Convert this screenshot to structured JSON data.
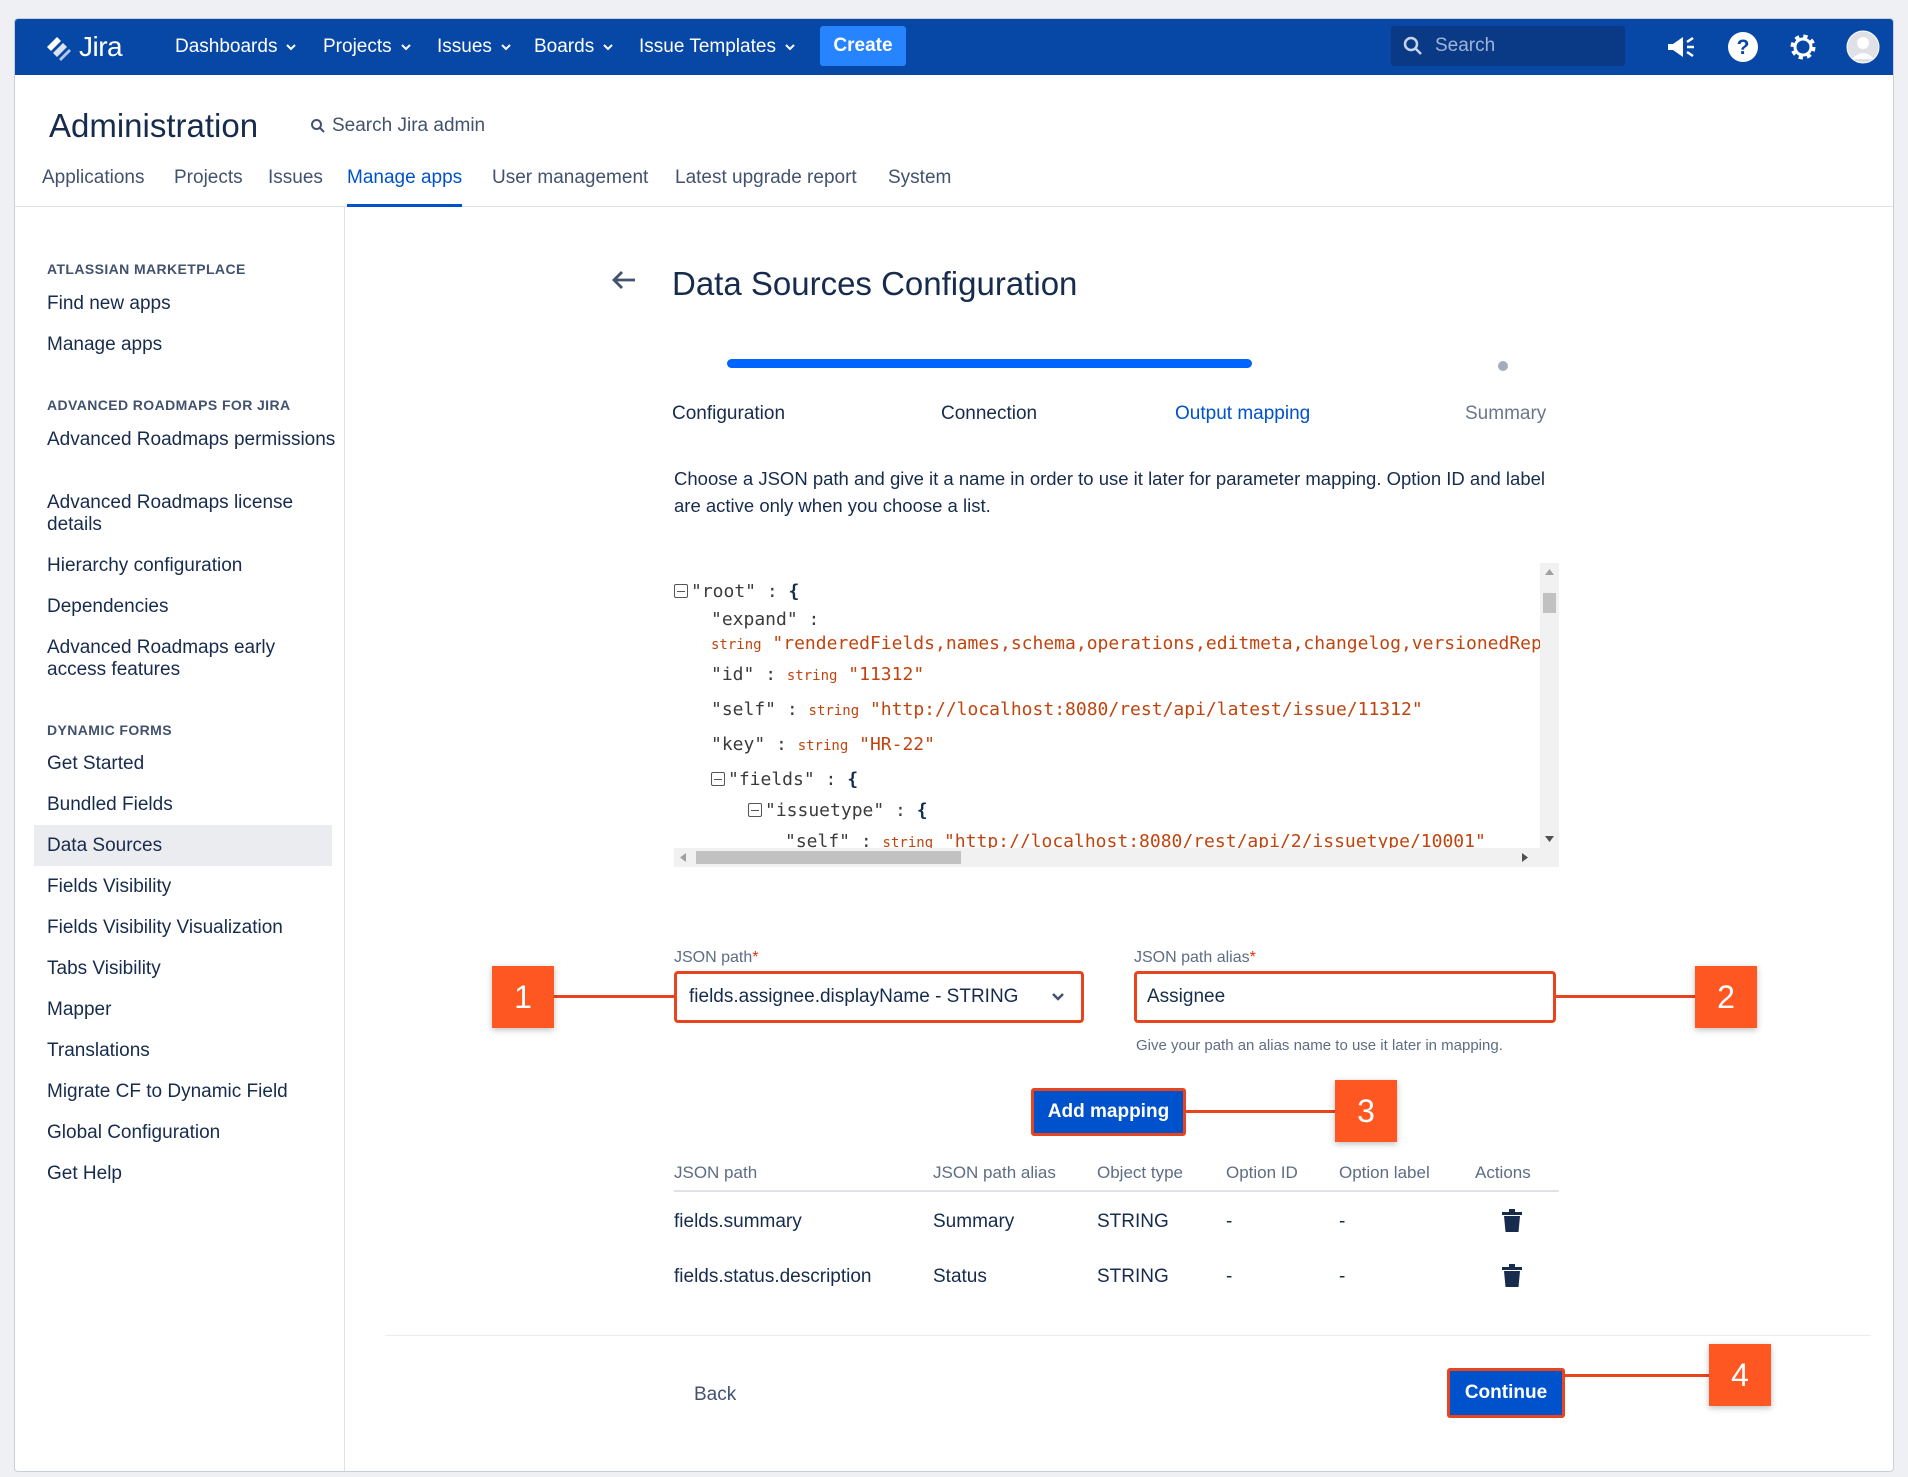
{
  "topnav": {
    "logo": "Jira",
    "items": [
      "Dashboards",
      "Projects",
      "Issues",
      "Boards",
      "Issue Templates"
    ],
    "create_label": "Create",
    "search_placeholder": "Search"
  },
  "admin": {
    "title": "Administration",
    "search_label": "Search Jira admin",
    "tabs": [
      "Applications",
      "Projects",
      "Issues",
      "Manage apps",
      "User management",
      "Latest upgrade report",
      "System"
    ],
    "active_tab": "Manage apps"
  },
  "sidebar": {
    "sections": [
      {
        "heading": "ATLASSIAN MARKETPLACE",
        "items": [
          "Find new apps",
          "Manage apps"
        ]
      },
      {
        "heading": "ADVANCED ROADMAPS FOR JIRA",
        "items": [
          "Advanced Roadmaps permissions",
          "Advanced Roadmaps license details",
          "Hierarchy configuration",
          "Dependencies",
          "Advanced Roadmaps early access features"
        ]
      },
      {
        "heading": "DYNAMIC FORMS",
        "items": [
          "Get Started",
          "Bundled Fields",
          "Data Sources",
          "Fields Visibility",
          "Fields Visibility Visualization",
          "Tabs Visibility",
          "Mapper",
          "Translations",
          "Migrate CF to Dynamic Field",
          "Global Configuration",
          "Get Help"
        ]
      }
    ],
    "selected": "Data Sources"
  },
  "page": {
    "title": "Data Sources Configuration",
    "progress_fraction": 0.75,
    "steps": [
      "Configuration",
      "Connection",
      "Output mapping",
      "Summary"
    ],
    "current_step": "Output mapping",
    "description": "Choose a JSON path and give it a name in order to use it later for parameter mapping. Option ID and label are active only when you choose a list."
  },
  "json_viewer": {
    "lines": [
      {
        "key": "\"root\"",
        "sep": " : ",
        "brace": "{"
      },
      {
        "key": "\"expand\"",
        "sep": " :"
      },
      {
        "type": "string",
        "value": "\"renderedFields,names,schema,operations,editmeta,changelog,versionedRepr"
      },
      {
        "key": "\"id\"",
        "sep": " : ",
        "type": "string",
        "value": "\"11312\""
      },
      {
        "key": "\"self\"",
        "sep": " : ",
        "type": "string",
        "value": "\"http://localhost:8080/rest/api/latest/issue/11312\""
      },
      {
        "key": "\"key\"",
        "sep": " : ",
        "type": "string",
        "value": "\"HR-22\""
      },
      {
        "key": "\"fields\"",
        "sep": " : ",
        "brace": "{"
      },
      {
        "key": "\"issuetype\"",
        "sep": " : ",
        "brace": "{"
      },
      {
        "key": "\"self\"",
        "sep": " : ",
        "type": "string",
        "value": "\"http://localhost:8080/rest/api/2/issuetype/10001\""
      }
    ]
  },
  "form": {
    "json_path_label": "JSON path",
    "json_path_value": "fields.assignee.displayName - STRING",
    "alias_label": "JSON path alias",
    "alias_value": "Assignee",
    "required_mark": "*",
    "helper": "Give your path an alias name to use it later in mapping.",
    "add_label": "Add mapping"
  },
  "table": {
    "headers": [
      "JSON path",
      "JSON path alias",
      "Object type",
      "Option ID",
      "Option label",
      "Actions"
    ],
    "rows": [
      [
        "fields.summary",
        "Summary",
        "STRING",
        "-",
        "-"
      ],
      [
        "fields.status.description",
        "Status",
        "STRING",
        "-",
        "-"
      ]
    ]
  },
  "footer": {
    "back_label": "Back",
    "continue_label": "Continue"
  },
  "callouts": [
    "1",
    "2",
    "3",
    "4"
  ],
  "colors": {
    "nav_bg": "#0747a6",
    "primary": "#0052cc",
    "callout": "#ff5722",
    "highlight_border": "#e8451e"
  }
}
